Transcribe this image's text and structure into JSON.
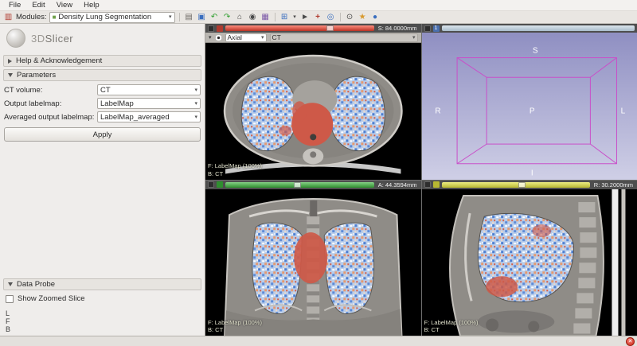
{
  "menubar": {
    "items": [
      "File",
      "Edit",
      "View",
      "Help"
    ]
  },
  "toolbar": {
    "modules_label": "Modules:",
    "module_combo": "Density Lung Segmentation",
    "icons": {
      "modules": "▥",
      "module_icon": "■",
      "combo_arrow": "▾",
      "load": "▤",
      "save": "▣",
      "history_back": "↶",
      "history_forward": "↷",
      "home": "⌂",
      "screenshot": "◉",
      "scene_view": "▦",
      "layout": "⊞",
      "layout_arrow": "▾",
      "cursor": "►",
      "place_point": "+",
      "crosshair": "◎",
      "zoom": "⊙",
      "extensions": "★",
      "volume": "●"
    }
  },
  "panel": {
    "logo1": "3D",
    "logo2": "Slicer",
    "sections": {
      "help": "Help & Acknowledgement",
      "parameters": "Parameters",
      "data_probe": "Data Probe"
    },
    "fields": {
      "ct_label": "CT volume:",
      "ct_value": "CT",
      "out_label": "Output labelmap:",
      "out_value": "LabelMap",
      "avg_label": "Averaged output labelmap:",
      "avg_value": "LabelMap_averaged"
    },
    "apply": "Apply",
    "probe": {
      "show_zoomed": "Show Zoomed Slice",
      "lines": [
        "L",
        "F",
        "B"
      ]
    }
  },
  "viewers": {
    "red": {
      "orientation": "Axial",
      "volume": "CT",
      "offset": "S: 84.0000mm",
      "fg": "F: LabelMap (100%)",
      "bg": "B: CT"
    },
    "green": {
      "offset": "A: 44.3594mm",
      "fg": "F: LabelMap (100%)",
      "bg": "B: CT"
    },
    "yellow": {
      "offset": "R: 30.2000mm",
      "fg": "F: LabelMap (100%)",
      "bg": "B: CT"
    },
    "threeD": {
      "badge": "1",
      "labels": {
        "s": "S",
        "i": "I",
        "r": "R",
        "l": "L",
        "p": "P"
      }
    }
  },
  "status": {
    "close": "✕"
  }
}
